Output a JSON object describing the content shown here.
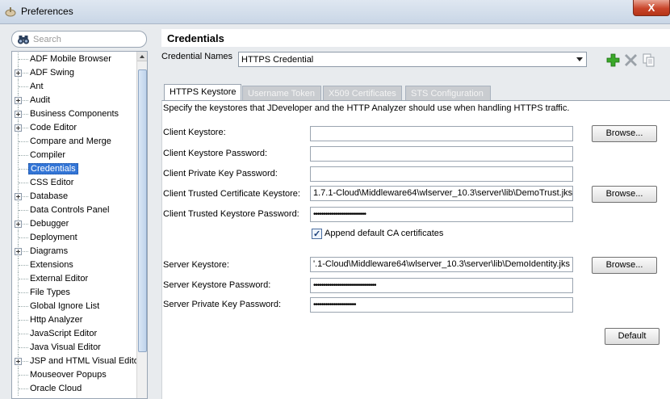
{
  "window": {
    "title": "Preferences",
    "close": "X"
  },
  "search": {
    "placeholder": "Search"
  },
  "tree": {
    "items": [
      {
        "label": "ADF Mobile Browser",
        "expandable": false
      },
      {
        "label": "ADF Swing",
        "expandable": true
      },
      {
        "label": "Ant",
        "expandable": false
      },
      {
        "label": "Audit",
        "expandable": true
      },
      {
        "label": "Business Components",
        "expandable": true
      },
      {
        "label": "Code Editor",
        "expandable": true
      },
      {
        "label": "Compare and Merge",
        "expandable": false
      },
      {
        "label": "Compiler",
        "expandable": false
      },
      {
        "label": "Credentials",
        "expandable": false,
        "selected": true
      },
      {
        "label": "CSS Editor",
        "expandable": false
      },
      {
        "label": "Database",
        "expandable": true
      },
      {
        "label": "Data Controls Panel",
        "expandable": false
      },
      {
        "label": "Debugger",
        "expandable": true
      },
      {
        "label": "Deployment",
        "expandable": false
      },
      {
        "label": "Diagrams",
        "expandable": true
      },
      {
        "label": "Extensions",
        "expandable": false
      },
      {
        "label": "External Editor",
        "expandable": false
      },
      {
        "label": "File Types",
        "expandable": false
      },
      {
        "label": "Global Ignore List",
        "expandable": false
      },
      {
        "label": "Http Analyzer",
        "expandable": false
      },
      {
        "label": "JavaScript Editor",
        "expandable": false
      },
      {
        "label": "Java Visual Editor",
        "expandable": false
      },
      {
        "label": "JSP and HTML Visual Editor",
        "expandable": true
      },
      {
        "label": "Mouseover Popups",
        "expandable": false
      },
      {
        "label": "Oracle Cloud",
        "expandable": false
      }
    ]
  },
  "page": {
    "title": "Credentials",
    "credential_names_label": "Credential Names",
    "credential_names_value": "HTTPS Credential",
    "tools": {
      "add": "add-icon",
      "delete": "delete-icon",
      "copy": "copy-icon"
    }
  },
  "tabs": [
    {
      "label": "HTTPS Keystore",
      "active": true
    },
    {
      "label": "Username Token",
      "active": false
    },
    {
      "label": "X509 Certificates",
      "active": false
    },
    {
      "label": "STS Configuration",
      "active": false
    }
  ],
  "form": {
    "description": "Specify the keystores that JDeveloper and the HTTP Analyzer should use when handling HTTPS traffic.",
    "client_keystore": {
      "label": "Client Keystore:",
      "value": ""
    },
    "client_keystore_password": {
      "label": "Client Keystore Password:",
      "value": ""
    },
    "client_private_key_password": {
      "label": "Client Private Key Password:",
      "value": ""
    },
    "client_trusted_cert_keystore": {
      "label": "Client Trusted Certificate Keystore:",
      "value": "1.7.1-Cloud\\Middleware64\\wlserver_10.3\\server\\lib\\DemoTrust.jks"
    },
    "client_trusted_keystore_password": {
      "label": "Client Trusted Keystore Password:",
      "value": "••••••••••••••••••••••••••"
    },
    "append_ca": {
      "label": "Append default CA certificates",
      "checked": true
    },
    "server_keystore": {
      "label": "Server Keystore:",
      "value": "'.1-Cloud\\Middleware64\\wlserver_10.3\\server\\lib\\DemoIdentity.jks"
    },
    "server_keystore_password": {
      "label": "Server Keystore Password:",
      "value": "•••••••••••••••••••••••••••••••"
    },
    "server_private_key_password": {
      "label": "Server Private Key Password:",
      "value": "•••••••••••••••••••••"
    },
    "browse_label": "Browse...",
    "default_label": "Default"
  },
  "colors": {
    "selection": "#3375d6",
    "add_green": "#3aa829",
    "tab_inactive": "#c9ccd0"
  }
}
